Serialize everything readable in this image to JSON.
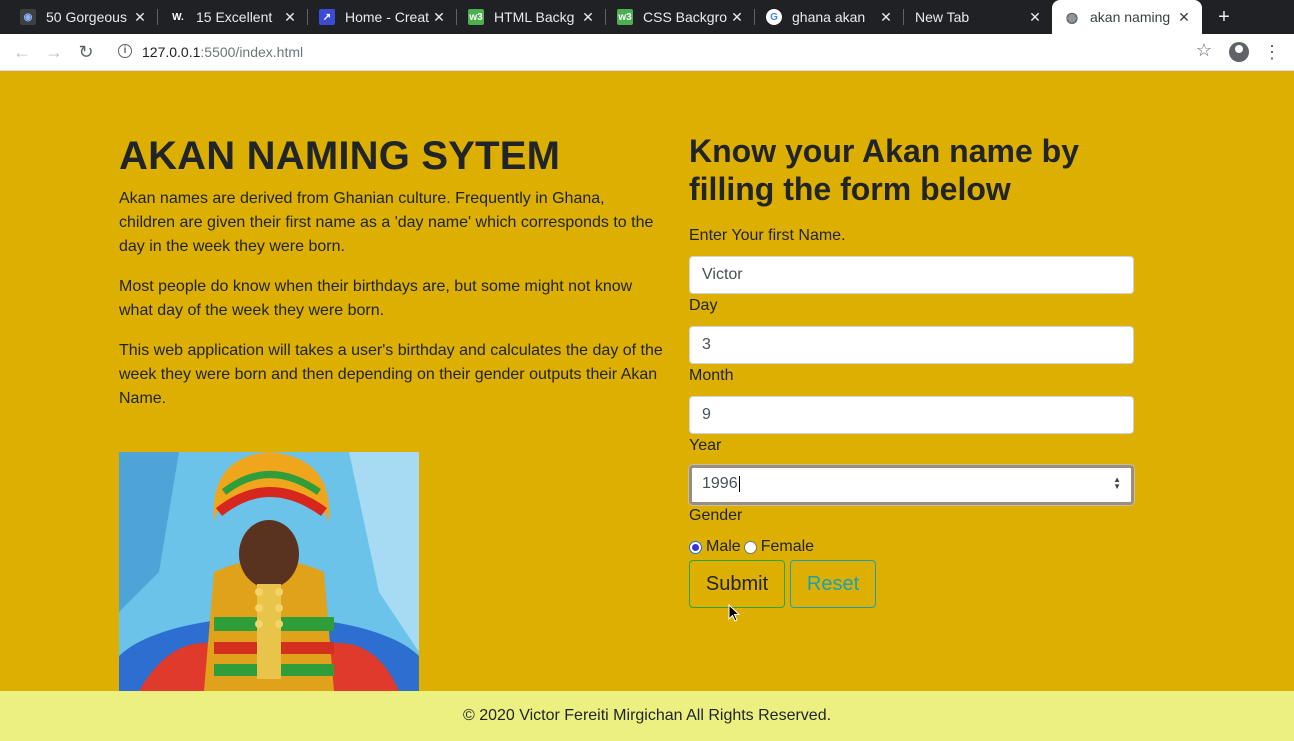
{
  "browser": {
    "tabs": [
      {
        "title": "50 Gorgeous",
        "icon": "tab-favicon-1"
      },
      {
        "title": "15 Excellent",
        "icon": "tab-favicon-w"
      },
      {
        "title": "Home - Creat",
        "icon": "tab-favicon-3"
      },
      {
        "title": "HTML Backg",
        "icon": "w3schools-icon"
      },
      {
        "title": "CSS Backgro",
        "icon": "w3schools-icon"
      },
      {
        "title": "ghana akan",
        "icon": "google-icon"
      },
      {
        "title": "New Tab",
        "icon": ""
      },
      {
        "title": "akan naming",
        "icon": "globe-icon"
      }
    ],
    "url_host": "127.0.0.1",
    "url_rest": ":5500/index.html"
  },
  "left": {
    "title": "AKAN NAMING SYTEM",
    "paragraphs": [
      "Akan names are derived from Ghanian culture. Frequently in Ghana, children are given their first name as a 'day name' which corresponds to the day in the week they were born.",
      "Most people do know when their birthdays are, but some might not know what day of the week they were born.",
      "This web application will takes a user's birthday and calculates the day of the week they were born and then depending on their gender outputs their Akan Name."
    ]
  },
  "form": {
    "title": "Know your Akan name by filling the form below",
    "name_label": "Enter Your first Name.",
    "name_value": "Victor",
    "day_label": "Day",
    "day_value": "3",
    "month_label": "Month",
    "month_value": "9",
    "year_label": "Year",
    "year_value": "1996",
    "gender_label": "Gender",
    "male_label": "Male",
    "female_label": "Female",
    "gender_selected": "Male",
    "submit_label": "Submit",
    "reset_label": "Reset"
  },
  "footer": {
    "text": "© 2020 Victor Fereiti Mirgichan All Rights Reserved."
  },
  "colors": {
    "page_bg": "#ddaf00",
    "footer_bg": "#ecf081",
    "tabstrip_bg": "#202124",
    "submit_border": "#28a745",
    "reset_color": "#17a2b8"
  }
}
